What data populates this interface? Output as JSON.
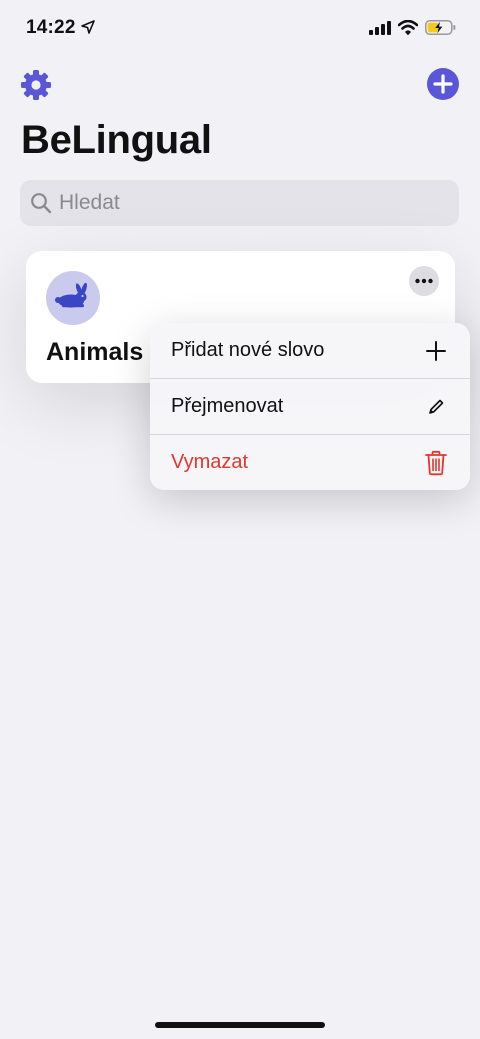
{
  "status": {
    "time": "14:22"
  },
  "app": {
    "title": "BeLingual"
  },
  "search": {
    "placeholder": "Hledat",
    "value": ""
  },
  "card": {
    "title": "Animals",
    "icon": "rabbit-icon"
  },
  "menu": {
    "items": [
      {
        "label": "Přidat nové slovo",
        "icon": "plus-icon"
      },
      {
        "label": "Přejmenovat",
        "icon": "pencil-icon"
      },
      {
        "label": "Vymazat",
        "icon": "trash-icon"
      }
    ]
  },
  "colors": {
    "accent": "#5a57d6",
    "destructive": "#e0372f",
    "background": "#f2f1f6",
    "avatar_bg": "#c9caee",
    "rabbit": "#3b46c4"
  }
}
